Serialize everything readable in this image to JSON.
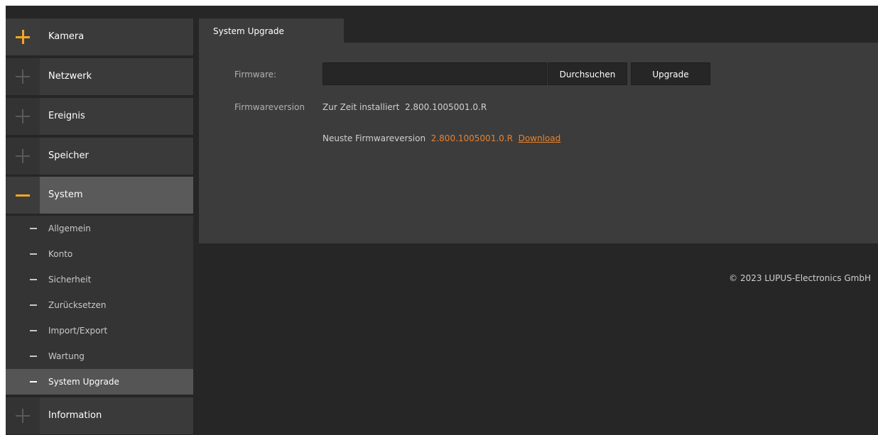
{
  "sidebar": {
    "items": [
      {
        "label": "Kamera"
      },
      {
        "label": "Netzwerk"
      },
      {
        "label": "Ereignis"
      },
      {
        "label": "Speicher"
      },
      {
        "label": "System"
      },
      {
        "label": "Information"
      }
    ],
    "system_subitems": [
      {
        "label": "Allgemein"
      },
      {
        "label": "Konto"
      },
      {
        "label": "Sicherheit"
      },
      {
        "label": "Zurücksetzen"
      },
      {
        "label": "Import/Export"
      },
      {
        "label": "Wartung"
      },
      {
        "label": "System Upgrade"
      }
    ]
  },
  "tabs": [
    {
      "label": "System Upgrade"
    }
  ],
  "upgrade": {
    "firmware_label": "Firmware:",
    "firmware_value": "",
    "browse_button": "Durchsuchen",
    "upgrade_button": "Upgrade",
    "version_label": "Firmwareversion",
    "installed_prefix": "Zur Zeit installiert",
    "installed_version": "2.800.1005001.0.R",
    "newest_prefix": "Neuste Firmwareversion",
    "newest_version": "2.800.1005001.0.R",
    "download_link": "Download"
  },
  "footer": {
    "copyright": "© 2023 LUPUS-Electronics GmbH"
  },
  "colors": {
    "accent": "#f5a623",
    "link": "#e8822e",
    "background": "#262626",
    "panel": "#3c3c3c"
  }
}
